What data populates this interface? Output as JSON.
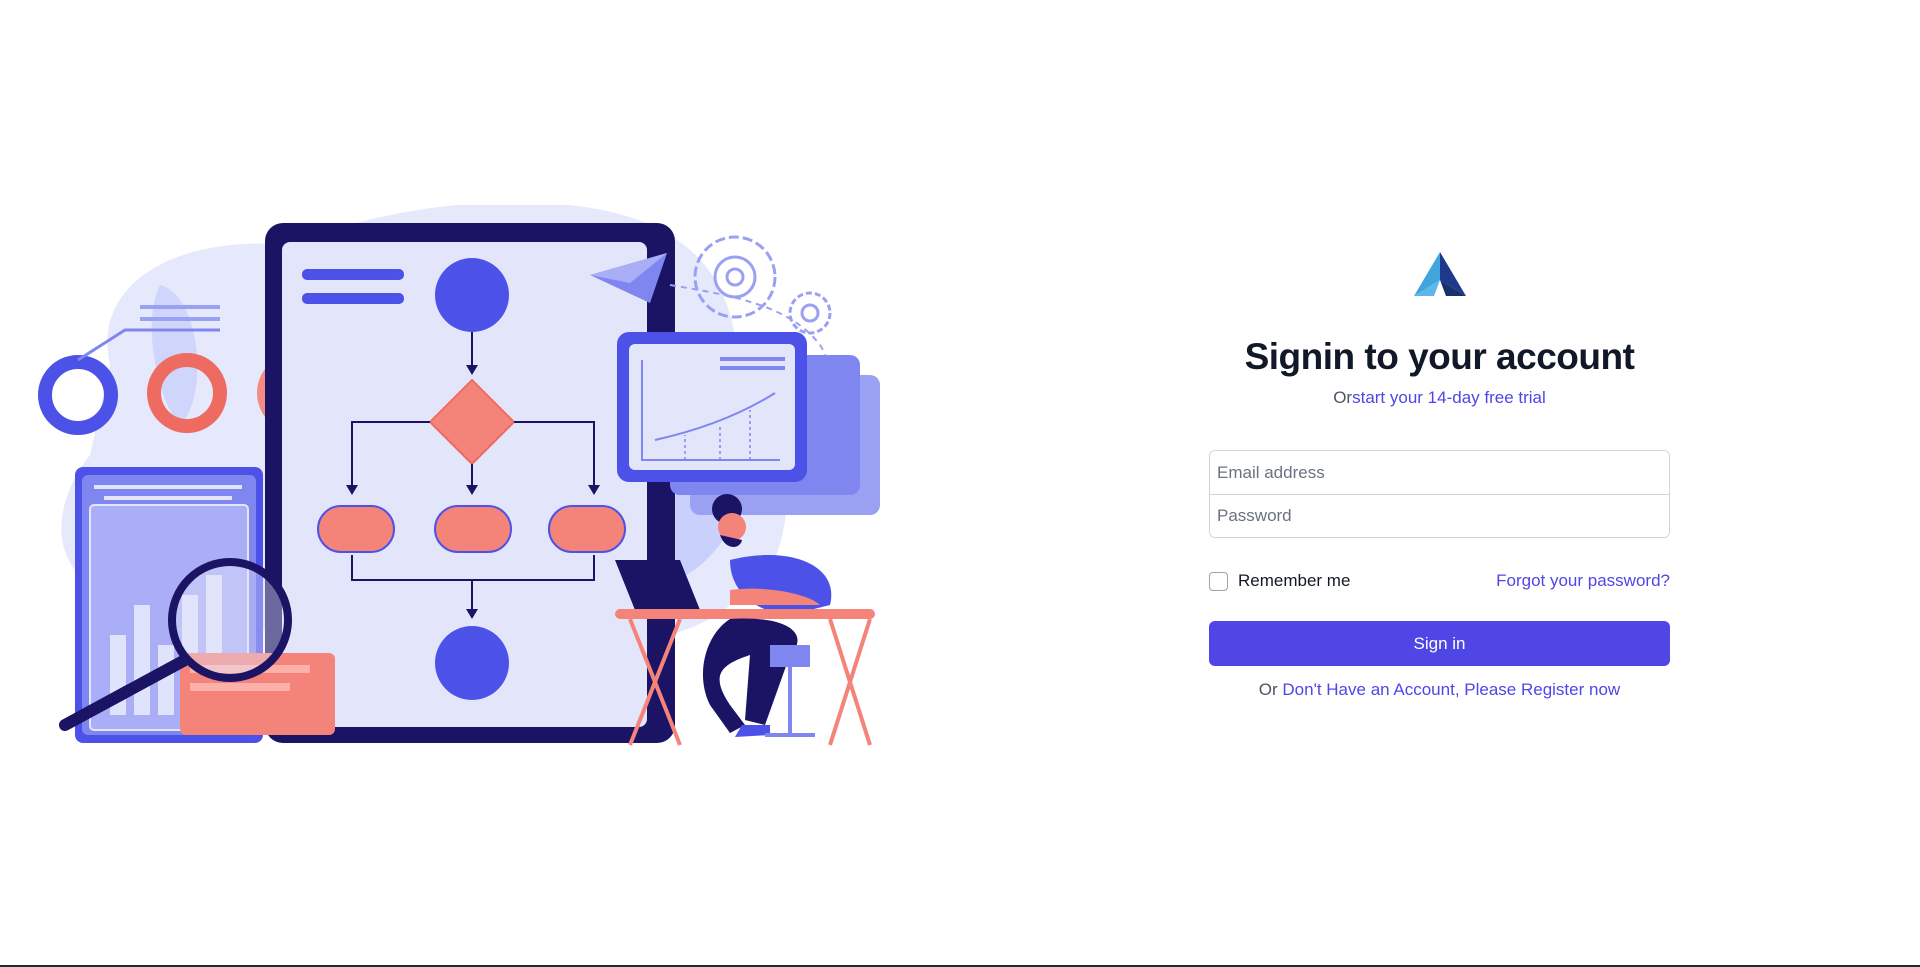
{
  "brand": {
    "logo_icon": "mountain-triangle-logo",
    "accent": "#4f46e5"
  },
  "illustration": {
    "icon": "workflow-analytics-illustration",
    "colors": {
      "blue": "#4c52e8",
      "navy": "#1b1464",
      "coral": "#f4847a",
      "light": "#dfe3fb"
    }
  },
  "form": {
    "title": "Signin to your account",
    "subtitle_prefix": "Or",
    "trial_link": "start your 14-day free trial",
    "email_placeholder": "Email address",
    "password_placeholder": "Password",
    "email_value": "",
    "password_value": "",
    "remember_label": "Remember me",
    "remember_checked": false,
    "forgot_link": "Forgot your password?",
    "submit_label": "Sign in",
    "register_prefix": "Or ",
    "register_link": "Don't Have an Account, Please Register now"
  }
}
